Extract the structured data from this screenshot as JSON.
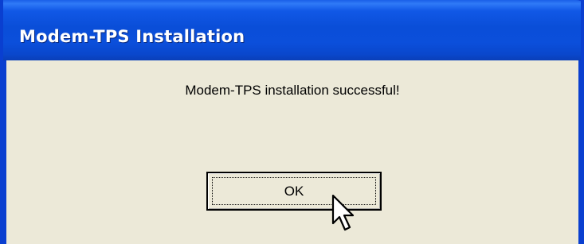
{
  "window": {
    "title": "Modem-TPS Installation"
  },
  "dialog": {
    "message": "Modem-TPS installation successful!",
    "ok_label": "OK"
  },
  "colors": {
    "titlebar": "#0a4ed8",
    "client_background": "#ece9d8",
    "title_text": "#ffffff"
  },
  "icons": {
    "cursor": "arrow-cursor-icon"
  }
}
